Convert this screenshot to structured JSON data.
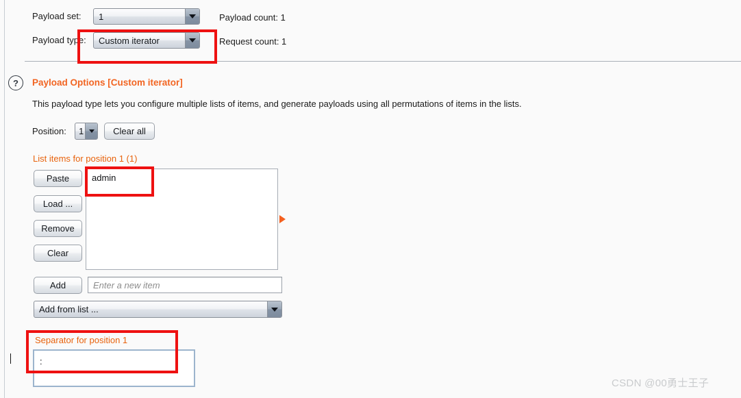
{
  "window": {
    "background": "#fafafa",
    "accent_orange": "#f26522",
    "annotation_color": "#ee1111"
  },
  "payload_header": {
    "payload_set_label": "Payload set:",
    "payload_set_value": "1",
    "payload_count_label": "Payload count:  1",
    "payload_type_label": "Payload type:",
    "payload_type_value": "Custom iterator",
    "request_count_label": "Request count:  1"
  },
  "payload_options": {
    "help_icon": "question-mark-icon",
    "title": "Payload Options [Custom iterator]",
    "description": "This payload type lets you configure multiple lists of items, and generate payloads using all permutations of items in the lists.",
    "position_label": "Position:",
    "position_value": "1",
    "clear_all_label": "Clear all"
  },
  "list_section": {
    "heading": "List items for position 1 (1)",
    "buttons": [
      {
        "label": "Paste",
        "name": "paste-button"
      },
      {
        "label": "Load ...",
        "name": "load-button"
      },
      {
        "label": "Remove",
        "name": "remove-button"
      },
      {
        "label": "Clear",
        "name": "clear-button"
      }
    ],
    "items": [
      "admin"
    ],
    "marker_icon": "triangle-right-icon",
    "add_label": "Add",
    "new_item_placeholder": "Enter a new item",
    "new_item_value": "",
    "add_from_list_value": "Add from list ..."
  },
  "separator_section": {
    "heading": "Separator for position 1",
    "value": ":"
  },
  "watermark": {
    "text": "CSDN @00勇士王子"
  }
}
